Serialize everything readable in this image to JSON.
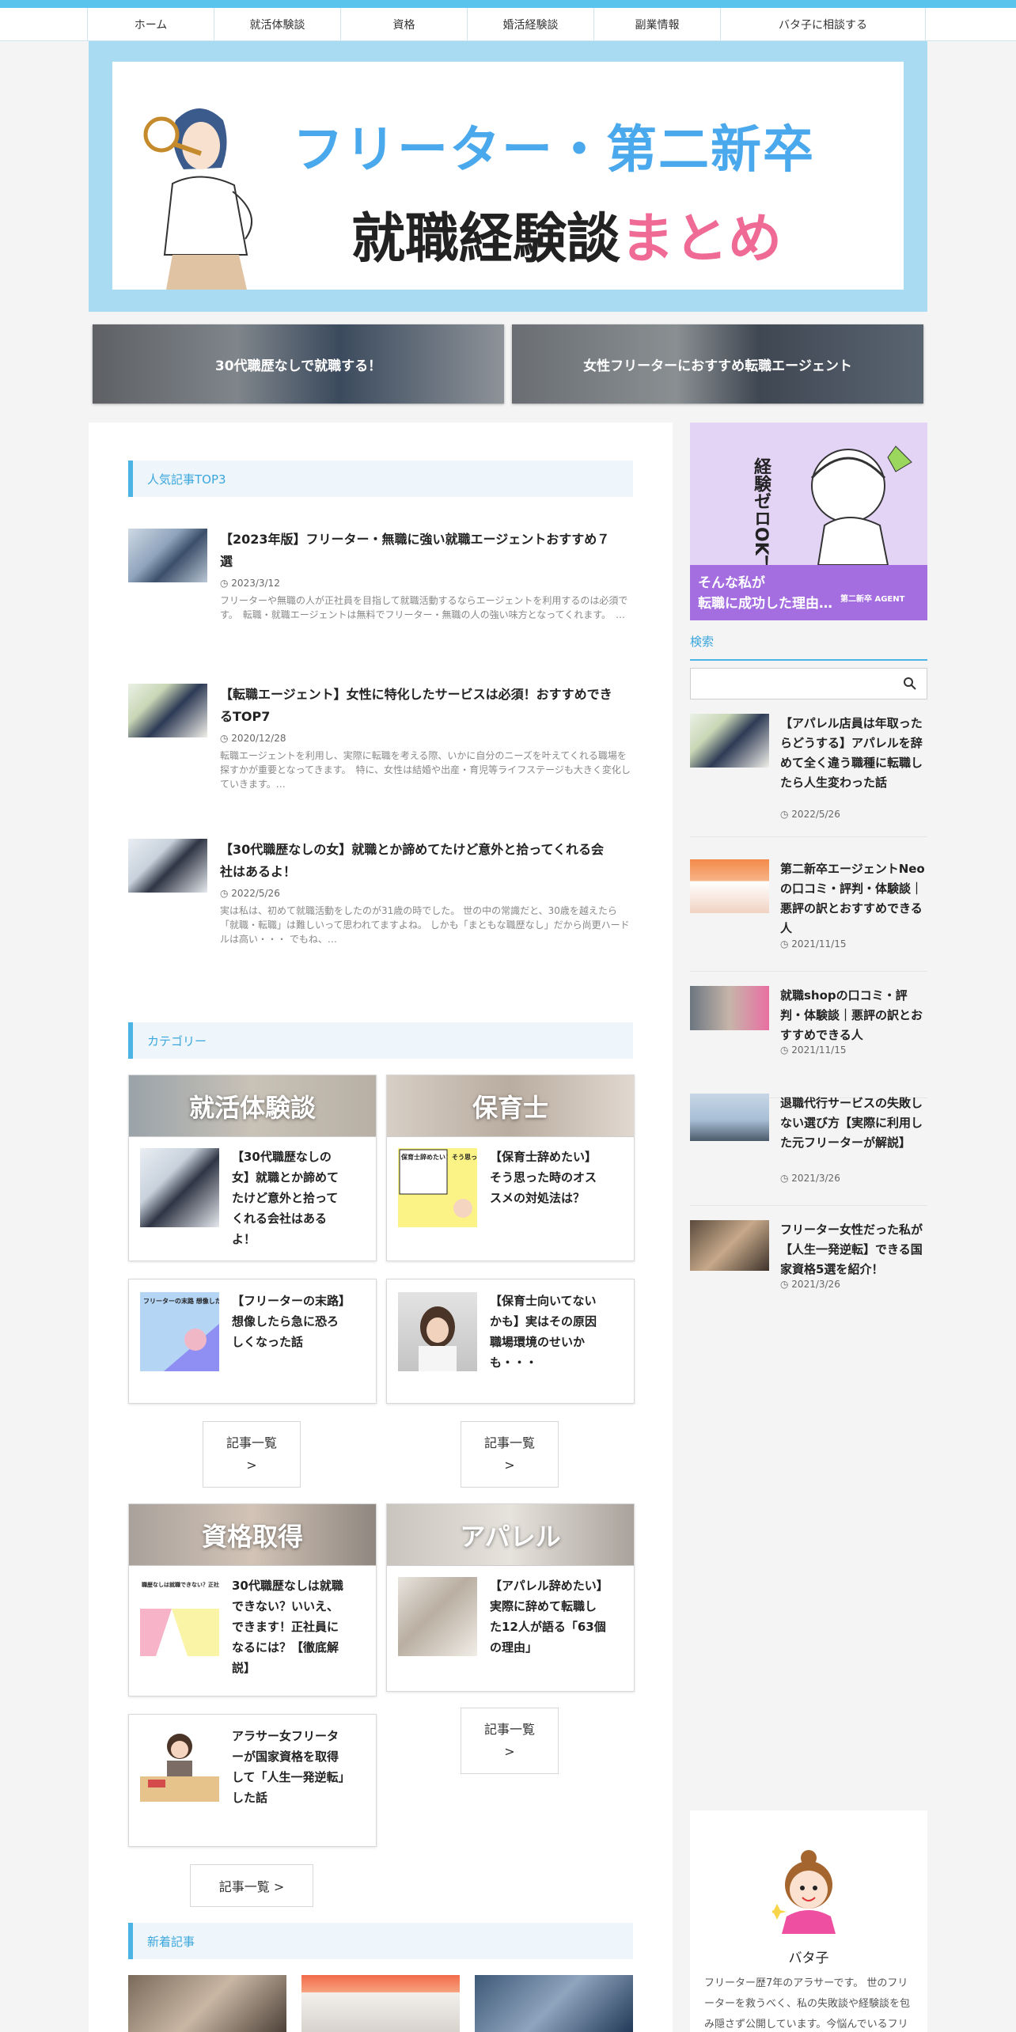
{
  "nav": {
    "items": [
      "ホーム",
      "就活体験談",
      "資格",
      "婚活経験談",
      "副業情報",
      "バタ子に相談する"
    ]
  },
  "hero": {
    "title_line1": "フリーター・第二新卒",
    "title_line2_black": "就職経験談",
    "title_line2_pink": "まとめ"
  },
  "banners": [
    {
      "label": "30代職歴なしで就職する！"
    },
    {
      "label": "女性フリーターにおすすめ転職エージェント"
    }
  ],
  "popular": {
    "heading": "人気記事TOP3",
    "items": [
      {
        "title": "【2023年版】フリーター・無職に強い就職エージェントおすすめ７選",
        "date": "2023/3/12",
        "excerpt": "フリーターや無職の人が正社員を目指して就職活動するならエージェントを利用するのは必須です。　転職・就職エージェントは無料でフリーター・無職の人の強い味方となってくれます。　…"
      },
      {
        "title": "【転職エージェント】女性に特化したサービスは必須！おすすめできるTOP7",
        "date": "2020/12/28",
        "excerpt": "転職エージェントを利用し、実際に転職を考える際、いかに自分のニーズを叶えてくれる職場を探すかが重要となってきます。　特に、女性は結婚や出産・育児等ライフステージも大きく変化していきます。…"
      },
      {
        "title": "【30代職歴なしの女】就職とか諦めてたけど意外と拾ってくれる会社はあるよ！",
        "date": "2022/5/26",
        "excerpt": "実は私は、初めて就職活動をしたのが31歳の時でした。 世の中の常識だと、30歳を越えたら「就職・転職」は難しいって思われてますよね。 しかも「まともな職歴なし」だから尚更ハードルは高い・・・ でもね、…"
      }
    ]
  },
  "categories": {
    "heading": "カテゴリー",
    "groups": [
      {
        "name": "就活体験談",
        "cards": [
          "【30代職歴なしの女】就職とか諦めてたけど意外と拾ってくれる会社はあるよ！",
          "【フリーターの末路】想像したら急に恐ろしくなった話"
        ],
        "more": "記事一覧\n>"
      },
      {
        "name": "保育士",
        "cards": [
          "【保育士辞めたい】そう思った時のオススメの対処法は？",
          "【保育士向いてないかも】実はその原因職場環境のせいかも・・・"
        ],
        "more": "記事一覧\n>"
      },
      {
        "name": "資格取得",
        "cards": [
          "30代職歴なしは就職できない？いいえ、できます！正社員になるには？【徹底解説】",
          "アラサー女フリーターが国家資格を取得して「人生一発逆転」した話"
        ],
        "more": "記事一覧 >"
      },
      {
        "name": "アパレル",
        "cards": [
          "【アパレル辞めたい】実際に辞めて転職した12人が語る「63個の理由」"
        ],
        "more": "記事一覧\n>"
      }
    ],
    "thumb_texts": {
      "hoikushi": "保育士辞めたい！そう思った時のオススメの対処法は？",
      "freeter": "フリーターの末路 想像したら急に恐ろしくなった話",
      "shikaku": "職歴なしは就職できない？正社員になるには？"
    }
  },
  "new_articles": {
    "heading": "新着記事"
  },
  "sidebar": {
    "ad": {
      "vertical": "経験ゼロOK！",
      "line1": "そんな私が",
      "line2": "転職に成功した理由…",
      "brand": "第二新卒 AGENT"
    },
    "search_label": "検索",
    "search_placeholder": "",
    "items": [
      {
        "title": "【アパレル店員は年取ったらどうする】アパレルを辞めて全く違う職種に転職したら人生変わった話",
        "date": "2022/5/26"
      },
      {
        "title": "第二新卒エージェントNeoの口コミ・評判・体験談｜悪評の訳とおすすめできる人",
        "date": "2021/11/15"
      },
      {
        "title": "就職shopの口コミ・評判・体験談｜悪評の訳とおすすめできる人",
        "date": "2021/11/15"
      },
      {
        "title": "退職代行サービスの失敗しない選び方【実際に利用した元フリーターが解説】",
        "date": "2021/3/26"
      },
      {
        "title": "フリーター女性だった私が【人生一発逆転】できる国家資格5選を紹介！",
        "date": "2021/3/26"
      }
    ],
    "profile": {
      "name": "バタ子",
      "text": "フリーター歴7年のアラサーです。 世のフリーターを救うべく、私の失敗談や経験談を包み隠さず公開しています。今悩んでいるフリ"
    }
  },
  "colors": {
    "accent": "#4cb4e5",
    "pink": "#ef6a94",
    "hero_bg": "#a9dcf3"
  }
}
